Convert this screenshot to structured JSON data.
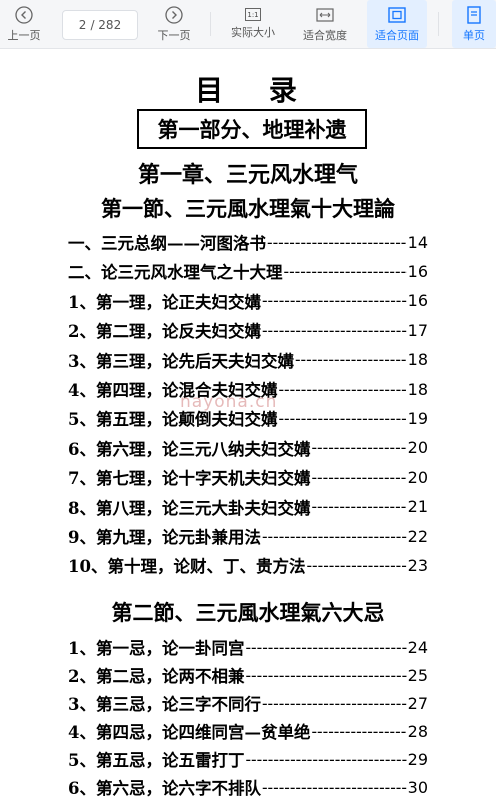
{
  "toolbar": {
    "prev_label": "上一页",
    "page_current": "2",
    "page_total": "/ 282",
    "next_label": "下一页",
    "actual_size_label": "实际大小",
    "fit_width_label": "适合宽度",
    "fit_page_label": "适合页面",
    "single_page_label": "单页",
    "actual_icon_text": "1:1"
  },
  "doc": {
    "toc_title": "目 录",
    "part_title": "第一部分、地理补遗",
    "chapter_title": "第一章、三元风水理气",
    "section1_title": "第一節、三元風水理氣十大理論",
    "section1_entries": [
      {
        "title": "一、三元总纲——河图洛书",
        "page": "14"
      },
      {
        "title": "二、论三元风水理气之十大理",
        "page": "16"
      },
      {
        "title": "1、第一理，论正夫妇交媾",
        "page": "16"
      },
      {
        "title": "2、第二理，论反夫妇交媾",
        "page": "17"
      },
      {
        "title": "3、第三理，论先后天夫妇交媾",
        "page": "18"
      },
      {
        "title": "4、第四理，论混合夫妇交媾",
        "page": "18"
      },
      {
        "title": "5、第五理，论颠倒夫妇交媾",
        "page": "19"
      },
      {
        "title": "6、第六理，论三元八纳夫妇交媾",
        "page": "20"
      },
      {
        "title": "7、第七理，论十字天机夫妇交媾",
        "page": "20"
      },
      {
        "title": "8、第八理，论三元大卦夫妇交媾",
        "page": "21"
      },
      {
        "title": "9、第九理，论元卦兼用法",
        "page": "22"
      },
      {
        "title": "10、第十理，论财、丁、贵方法",
        "page": "23"
      }
    ],
    "section2_title": "第二節、三元風水理氣六大忌",
    "section2_entries": [
      {
        "title": "1、第一忌，论一卦同宫",
        "page": "24"
      },
      {
        "title": "2、第二忌，论两不相兼",
        "page": "25"
      },
      {
        "title": "3、第三忌，论三字不同行",
        "page": "27"
      },
      {
        "title": "4、第四忌，论四维同宫—贫单绝",
        "page": "28"
      },
      {
        "title": "5、第五忌，论五雷打丁",
        "page": "29"
      },
      {
        "title": "6、第六忌，论六字不排队",
        "page": "30"
      }
    ],
    "watermark": "nayona.cn"
  },
  "colors": {
    "accent": "#1677ff",
    "toolbar_bg": "#f5f6f8",
    "active_bg": "#e3efff"
  }
}
